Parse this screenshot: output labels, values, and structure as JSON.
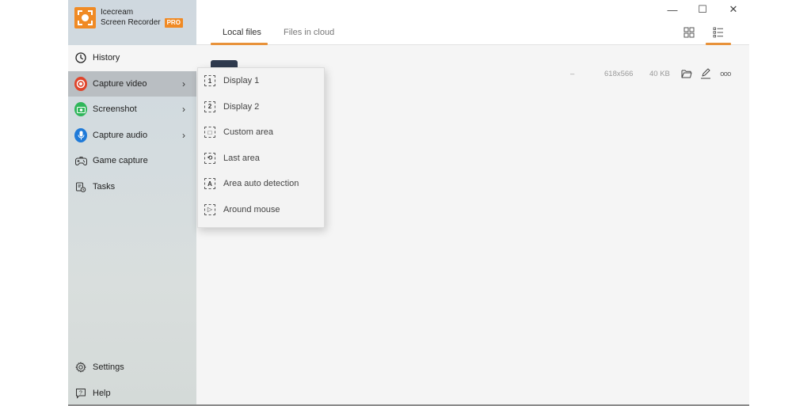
{
  "app": {
    "name_line1": "Icecream",
    "name_line2": "Screen Recorder",
    "badge": "PRO",
    "accent_color": "#f08a24"
  },
  "window_controls": {
    "minimize": "—",
    "maximize": "☐",
    "close": "✕"
  },
  "sidebar": {
    "items": [
      {
        "label": "History",
        "icon": "clock-icon"
      },
      {
        "label": "Capture video",
        "icon": "record-icon",
        "has_submenu": true,
        "active": true
      },
      {
        "label": "Screenshot",
        "icon": "camera-icon",
        "has_submenu": true
      },
      {
        "label": "Capture audio",
        "icon": "microphone-icon",
        "has_submenu": true
      },
      {
        "label": "Game capture",
        "icon": "gamepad-icon"
      },
      {
        "label": "Tasks",
        "icon": "tasks-icon"
      }
    ],
    "bottom": [
      {
        "label": "Settings",
        "icon": "gear-icon"
      },
      {
        "label": "Help",
        "icon": "help-icon"
      }
    ],
    "chevron": "›"
  },
  "tabs": [
    {
      "label": "Local files",
      "active": true
    },
    {
      "label": "Files in cloud",
      "active": false
    }
  ],
  "view_toggle": {
    "grid": "grid-view-icon",
    "list": "list-view-icon",
    "active": "list"
  },
  "file_row": {
    "duration": "–",
    "resolution": "618x566",
    "size": "40 KB",
    "more": "ooo"
  },
  "submenu": {
    "items": [
      {
        "label": "Display 1",
        "glyph": "1"
      },
      {
        "label": "Display 2",
        "glyph": "2"
      },
      {
        "label": "Custom area",
        "glyph": "□"
      },
      {
        "label": "Last area",
        "glyph": "⟲"
      },
      {
        "label": "Area auto detection",
        "glyph": "A"
      },
      {
        "label": "Around mouse",
        "glyph": "▷"
      }
    ]
  }
}
